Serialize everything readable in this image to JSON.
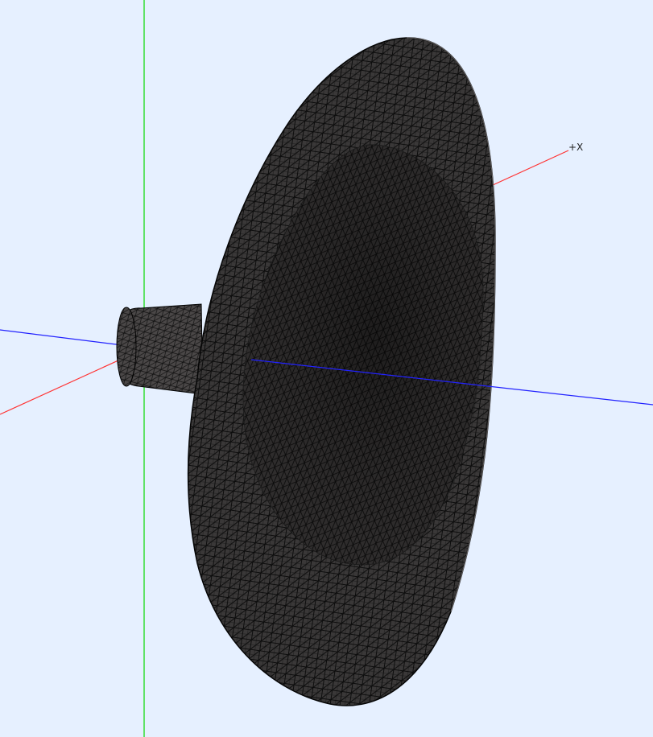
{
  "viewport": {
    "background_color": "#e6f0ff"
  },
  "axes": {
    "x": {
      "label": "+X",
      "color": "#ff3333"
    },
    "y": {
      "color": "#33dd33"
    },
    "z": {
      "color": "#2222ff"
    }
  },
  "model": {
    "shape": "horn-flare",
    "render_mode": "wireframe-mesh",
    "fill_color": "#3a3838",
    "edge_color": "#0d0d0d"
  }
}
